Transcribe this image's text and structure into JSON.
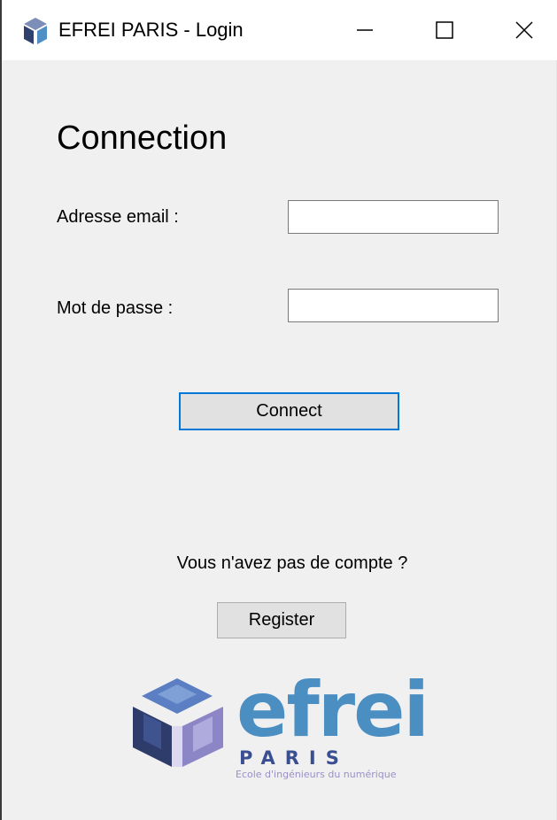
{
  "window": {
    "title": "EFREI PARIS - Login",
    "controls": {
      "minimize": "minimize-icon",
      "maximize": "maximize-icon",
      "close": "close-icon"
    }
  },
  "form": {
    "heading": "Connection",
    "email_label": "Adresse email :",
    "email_value": "",
    "password_label": "Mot de passe :",
    "password_value": "",
    "connect_label": "Connect"
  },
  "register": {
    "prompt": "Vous n'avez pas de compte ?",
    "button_label": "Register"
  },
  "logo": {
    "word": "efrei",
    "city": "PARIS",
    "tagline": "Ecole d'ingénieurs du numérique"
  },
  "colors": {
    "window_bg": "#f0f0f0",
    "titlebar_bg": "#ffffff",
    "focus_border": "#0078d7",
    "button_bg": "#e1e1e1",
    "logo_blue": "#4a8ec2",
    "logo_navy": "#3a4e92",
    "logo_lavender": "#9b8fc8"
  }
}
